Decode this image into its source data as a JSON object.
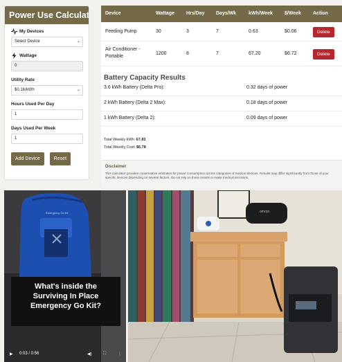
{
  "calculator": {
    "title": "Power Use Calculator",
    "devices_label": "My Devices",
    "device_select": "Select Device",
    "wattage_label": "Wattage",
    "wattage_value": "0",
    "utility_label": "Utility Rate",
    "utility_value": "$0.16/kWh",
    "hours_label": "Hours Used Per Day",
    "hours_value": "1",
    "days_label": "Days Used Per Week",
    "days_value": "1",
    "add_button": "Add Device",
    "reset_button": "Reset"
  },
  "table": {
    "headers": [
      "Device",
      "Wattage",
      "Hrs/Day",
      "Days/Wk",
      "kWh/Week",
      "$/Week",
      "Action"
    ],
    "rows": [
      {
        "device": "Feeding Pump",
        "wattage": "30",
        "hours": "3",
        "days": "7",
        "kwh": "0.63",
        "cost": "$0.06",
        "action": "Delete"
      },
      {
        "device_line1": "Air Conditioner -",
        "device_line2": "Portable",
        "wattage": "1200",
        "hours": "8",
        "days": "7",
        "kwh": "67.20",
        "cost": "$6.72",
        "action": "Delete"
      }
    ]
  },
  "battery": {
    "title": "Battery Capacity Results",
    "rows": [
      {
        "name": "3.6 kWh Battery (Delta Pro):",
        "result": "0.32 days of power"
      },
      {
        "name": "2 kWh Battery (Delta 2 Max):",
        "result": "0.18 days of power"
      },
      {
        "name": "1 kWh Battery (Delta 2):",
        "result": "0.09 days of power"
      }
    ]
  },
  "totals": {
    "kwh_label": "Total Weekly kWh:",
    "kwh_value": "67.83",
    "cost_label": "Total Weekly Cost:",
    "cost_value": "$6.78"
  },
  "disclaimer": {
    "title": "Disclaimer",
    "text": "This calculator provides conservative estimates for power consumption across categories of medical devices. Results may differ significantly from those of your specific devices depending on several factors. Do not rely on these results to make medical decisions."
  },
  "video": {
    "bag_label": "Emergency Go Kit",
    "caption_line1": "What's inside the",
    "caption_line2": "Surviving In Place",
    "caption_line3": "Emergency Go Kit?",
    "time": "0:03 / 0:56"
  },
  "photo": {
    "brand_label": "omron"
  },
  "colors": {
    "brand": "#756a47",
    "delete": "#b8262b",
    "disclaimer_title": "#6b5e3a"
  }
}
